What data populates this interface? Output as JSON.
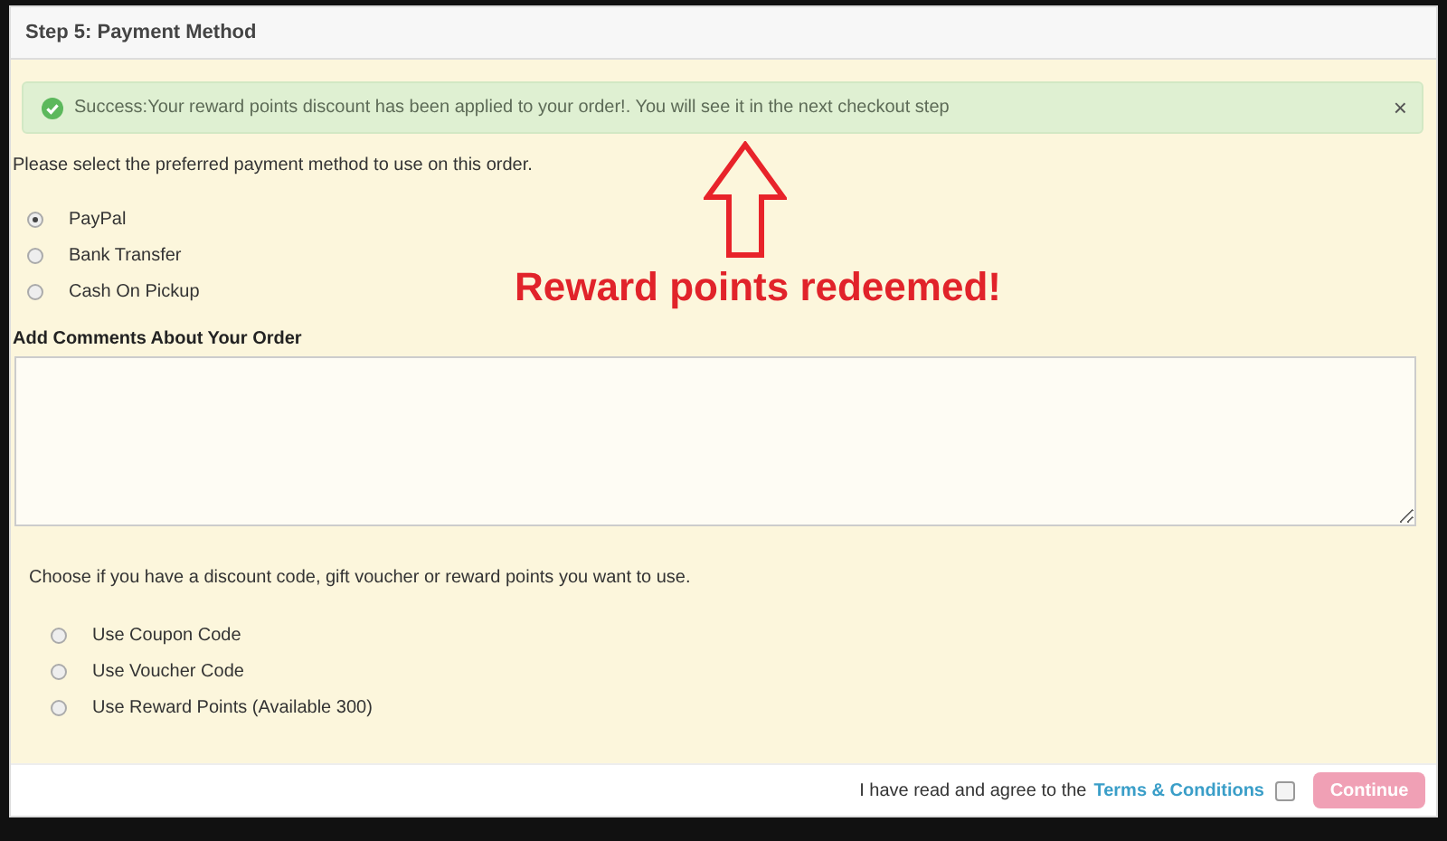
{
  "panel": {
    "title": "Step 5: Payment Method"
  },
  "alert": {
    "kind": "success",
    "text": "Success:Your reward points discount has been applied to your order!. You will see it in the next checkout step",
    "close": "×"
  },
  "payment": {
    "intro": "Please select the preferred payment method to use on this order.",
    "options": [
      {
        "label": "PayPal",
        "selected": true
      },
      {
        "label": "Bank Transfer",
        "selected": false
      },
      {
        "label": "Cash On Pickup",
        "selected": false
      }
    ]
  },
  "comments": {
    "label": "Add Comments About Your Order"
  },
  "discounts": {
    "intro": "Choose if you have a discount code, gift voucher or reward points you want to use.",
    "options": [
      {
        "label": "Use Coupon Code",
        "selected": false
      },
      {
        "label": "Use Voucher Code",
        "selected": false
      },
      {
        "label": "Use Reward Points (Available 300)",
        "selected": false
      }
    ]
  },
  "footer": {
    "agree_text": "I have read and agree to the",
    "terms_link": "Terms & Conditions",
    "agreed": false,
    "button": "Continue",
    "button_disabled": true
  },
  "annotation": {
    "text": "Reward points redeemed!"
  }
}
